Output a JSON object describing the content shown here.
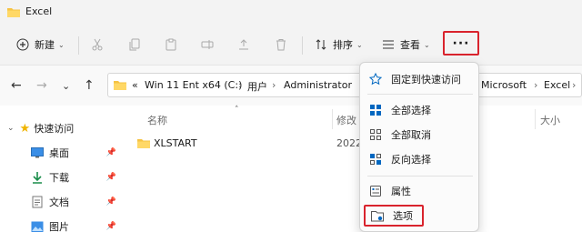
{
  "window": {
    "title": "Excel"
  },
  "toolbar": {
    "new_label": "新建",
    "sort_label": "排序",
    "view_label": "查看",
    "more_label": "···"
  },
  "address": {
    "prefix": "«",
    "path": [
      "Win 11 Ent x64 (C:)",
      "用户",
      "Administrator"
    ],
    "path_tail": [
      "Microsoft",
      "Excel"
    ]
  },
  "sidebar": {
    "quick_access": "快速访问",
    "items": [
      {
        "label": "桌面"
      },
      {
        "label": "下载"
      },
      {
        "label": "文档"
      },
      {
        "label": "图片"
      }
    ]
  },
  "content": {
    "headers": {
      "name": "名称",
      "modified": "修改",
      "size": "大小"
    },
    "rows": [
      {
        "name": "XLSTART",
        "date": "2022"
      }
    ]
  },
  "menu": {
    "items": [
      {
        "label": "固定到快速访问"
      },
      {
        "label": "全部选择"
      },
      {
        "label": "全部取消"
      },
      {
        "label": "反向选择"
      },
      {
        "label": "属性"
      },
      {
        "label": "选项"
      }
    ]
  },
  "colors": {
    "accent": "#0067c0",
    "highlight": "#d9232d",
    "folder": "#f6c343"
  }
}
